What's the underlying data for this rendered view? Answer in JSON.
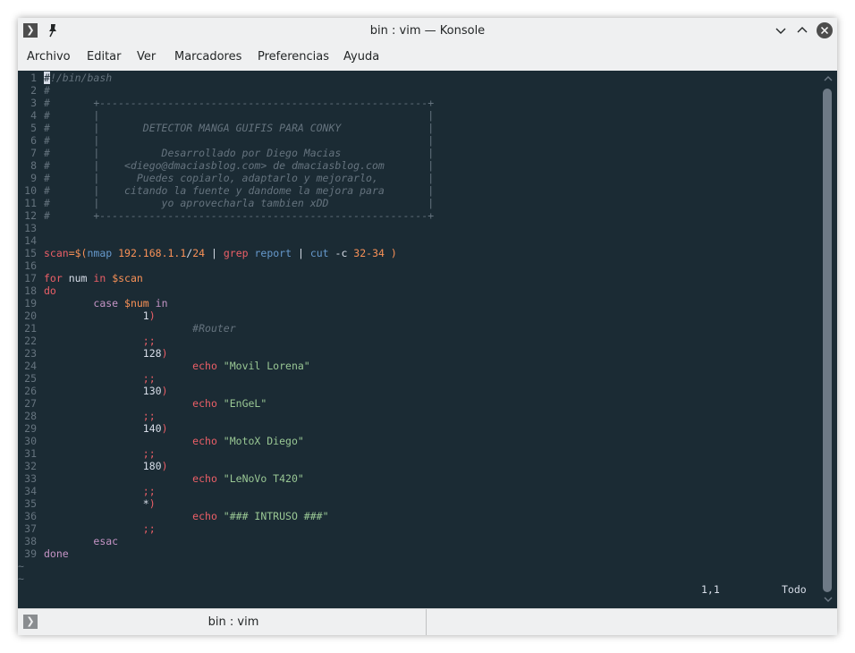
{
  "window": {
    "title": "bin : vim — Konsole"
  },
  "icons": {
    "menu": "terminal-prompt-icon",
    "pin": "pin-icon",
    "minimize": "chevron-down-icon",
    "maximize": "chevron-up-icon",
    "close": "close-icon",
    "new_tab": "terminal-prompt-icon"
  },
  "menubar": {
    "items": [
      "Archivo",
      "Editar",
      "Ver",
      "Marcadores",
      "Preferencias",
      "Ayuda"
    ]
  },
  "editor": {
    "lines": [
      {
        "n": "1",
        "t": [
          [
            "cursor",
            "#"
          ],
          [
            "comment",
            "!/bin/bash"
          ]
        ]
      },
      {
        "n": "2",
        "t": [
          [
            "comment",
            "#"
          ]
        ]
      },
      {
        "n": "3",
        "t": [
          [
            "comment",
            "#       +-----------------------------------------------------+"
          ]
        ]
      },
      {
        "n": "4",
        "t": [
          [
            "comment",
            "#       |                                                     |"
          ]
        ]
      },
      {
        "n": "5",
        "t": [
          [
            "comment",
            "#       |       DETECTOR MANGA GUIFIS PARA CONKY              |"
          ]
        ]
      },
      {
        "n": "6",
        "t": [
          [
            "comment",
            "#       |                                                     |"
          ]
        ]
      },
      {
        "n": "7",
        "t": [
          [
            "comment",
            "#       |          Desarrollado por Diego Macias              |"
          ]
        ]
      },
      {
        "n": "8",
        "t": [
          [
            "comment",
            "#       |    <diego@dmaciasblog.com> de dmaciasblog.com       |"
          ]
        ]
      },
      {
        "n": "9",
        "t": [
          [
            "comment",
            "#       |      Puedes copiarlo, adaptarlo y mejorarlo,        |"
          ]
        ]
      },
      {
        "n": "10",
        "t": [
          [
            "comment",
            "#       |    citando la fuente y dandome la mejora para       |"
          ]
        ]
      },
      {
        "n": "11",
        "t": [
          [
            "comment",
            "#       |          yo aprovecharla tambien xDD                |"
          ]
        ]
      },
      {
        "n": "12",
        "t": [
          [
            "comment",
            "#       +-----------------------------------------------------+"
          ]
        ]
      },
      {
        "n": "13",
        "t": []
      },
      {
        "n": "14",
        "t": []
      },
      {
        "n": "15",
        "t": [
          [
            "var",
            "scan"
          ],
          [
            "op",
            "=$("
          ],
          [
            "cmd",
            "nmap "
          ],
          [
            "num",
            "192.168.1.1"
          ],
          [
            "plain",
            "/"
          ],
          [
            "num",
            "24"
          ],
          [
            "plain",
            " | "
          ],
          [
            "var",
            "grep "
          ],
          [
            "cmd",
            "report"
          ],
          [
            "plain",
            " | "
          ],
          [
            "cmd",
            "cut "
          ],
          [
            "plain",
            "-c "
          ],
          [
            "num",
            "32-34"
          ],
          [
            "op",
            " )"
          ]
        ]
      },
      {
        "n": "16",
        "t": []
      },
      {
        "n": "17",
        "t": [
          [
            "var",
            "for "
          ],
          [
            "plain",
            "num "
          ],
          [
            "var",
            "in "
          ],
          [
            "op",
            "$scan"
          ]
        ]
      },
      {
        "n": "18",
        "t": [
          [
            "var",
            "do"
          ]
        ]
      },
      {
        "n": "19",
        "t": [
          [
            "plain",
            "        "
          ],
          [
            "kw",
            "case "
          ],
          [
            "op",
            "$num "
          ],
          [
            "kw",
            "in"
          ]
        ]
      },
      {
        "n": "20",
        "t": [
          [
            "plain",
            "                1"
          ],
          [
            "var",
            ")"
          ]
        ]
      },
      {
        "n": "21",
        "t": [
          [
            "plain",
            "                        "
          ],
          [
            "comment",
            "#Router"
          ]
        ]
      },
      {
        "n": "22",
        "t": [
          [
            "plain",
            "                "
          ],
          [
            "var",
            ";;"
          ]
        ]
      },
      {
        "n": "23",
        "t": [
          [
            "plain",
            "                128"
          ],
          [
            "var",
            ")"
          ]
        ]
      },
      {
        "n": "24",
        "t": [
          [
            "plain",
            "                        "
          ],
          [
            "var",
            "echo "
          ],
          [
            "str",
            "\"Movil Lorena\""
          ]
        ]
      },
      {
        "n": "25",
        "t": [
          [
            "plain",
            "                "
          ],
          [
            "var",
            ";;"
          ]
        ]
      },
      {
        "n": "26",
        "t": [
          [
            "plain",
            "                130"
          ],
          [
            "var",
            ")"
          ]
        ]
      },
      {
        "n": "27",
        "t": [
          [
            "plain",
            "                        "
          ],
          [
            "var",
            "echo "
          ],
          [
            "str",
            "\"EnGeL\""
          ]
        ]
      },
      {
        "n": "28",
        "t": [
          [
            "plain",
            "                "
          ],
          [
            "var",
            ";;"
          ]
        ]
      },
      {
        "n": "29",
        "t": [
          [
            "plain",
            "                140"
          ],
          [
            "var",
            ")"
          ]
        ]
      },
      {
        "n": "30",
        "t": [
          [
            "plain",
            "                        "
          ],
          [
            "var",
            "echo "
          ],
          [
            "str",
            "\"MotoX Diego\""
          ]
        ]
      },
      {
        "n": "31",
        "t": [
          [
            "plain",
            "                "
          ],
          [
            "var",
            ";;"
          ]
        ]
      },
      {
        "n": "32",
        "t": [
          [
            "plain",
            "                180"
          ],
          [
            "var",
            ")"
          ]
        ]
      },
      {
        "n": "33",
        "t": [
          [
            "plain",
            "                        "
          ],
          [
            "var",
            "echo "
          ],
          [
            "str",
            "\"LeNoVo T420\""
          ]
        ]
      },
      {
        "n": "34",
        "t": [
          [
            "plain",
            "                "
          ],
          [
            "var",
            ";;"
          ]
        ]
      },
      {
        "n": "35",
        "t": [
          [
            "plain",
            "                *"
          ],
          [
            "var",
            ")"
          ]
        ]
      },
      {
        "n": "36",
        "t": [
          [
            "plain",
            "                        "
          ],
          [
            "var",
            "echo "
          ],
          [
            "str",
            "\"### INTRUSO ###\""
          ]
        ]
      },
      {
        "n": "37",
        "t": [
          [
            "plain",
            "                "
          ],
          [
            "var",
            ";;"
          ]
        ]
      },
      {
        "n": "38",
        "t": [
          [
            "plain",
            "        "
          ],
          [
            "kw",
            "esac"
          ]
        ]
      },
      {
        "n": "39",
        "t": [
          [
            "kw",
            "done"
          ]
        ]
      }
    ],
    "tildes": [
      "~",
      "~"
    ],
    "status_position": "1,1",
    "status_scroll": "Todo"
  },
  "tabbar": {
    "tab_label": "bin : vim"
  },
  "colors": {
    "background": "#1b2b34",
    "comment": "#65737e",
    "keyword_red": "#ec5f67",
    "number_orange": "#f99157",
    "command_blue": "#6699cc",
    "string_green": "#99c794",
    "keyword_purple": "#c594c5",
    "chrome": "#eff0f1"
  }
}
